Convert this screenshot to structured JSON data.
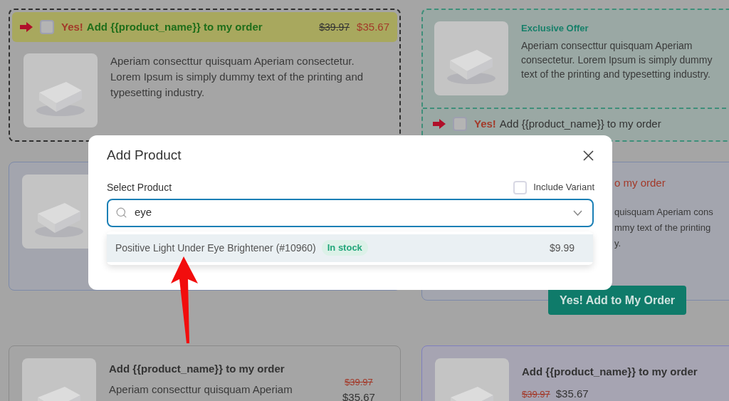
{
  "left_cards": [
    {
      "kind": "header-offer",
      "checked": false,
      "yes_label": "Yes!",
      "title": "Add {{product_name}} to my order",
      "old_price": "$39.97",
      "new_price": "$35.67",
      "description": "Aperiam consecttur quisquam Aperiam consectetur. Lorem Ipsum is simply dummy text of the printing and typesetting industry."
    },
    {
      "kind": "covered"
    },
    {
      "kind": "side-price",
      "title": "Add {{product_name}} to my order",
      "description": "Aperiam consecttur quisquam Aperiam",
      "old_price": "$39.97",
      "new_price": "$35.67"
    }
  ],
  "right_cards": [
    {
      "kind": "footer-offer",
      "badge": "Exclusive Offer",
      "description": "Aperiam consecttur quisquam Aperiam consectetur. Lorem Ipsum is simply dummy text of the printing and typesetting industry.",
      "checked": false,
      "yes_label": "Yes!",
      "title": "Add {{product_name}} to my order"
    },
    {
      "kind": "fragment",
      "title": "o my order",
      "lines": [
        "quisquam Aperiam cons",
        "mmy text of the printing",
        "y."
      ],
      "button": "Yes! Add to My Order"
    },
    {
      "kind": "inline-price",
      "title": "Add {{product_name}} to my order",
      "old_price": "$39.97",
      "new_price": "$35.67"
    }
  ],
  "modal": {
    "title": "Add Product",
    "field_label": "Select Product",
    "include_variant": {
      "label": "Include Variant",
      "checked": false
    },
    "search": {
      "value": "eye"
    },
    "options": [
      {
        "name": "Positive Light Under Eye Brightener (#10960)",
        "stock": "In stock",
        "price": "$9.99",
        "selected": true
      }
    ]
  }
}
